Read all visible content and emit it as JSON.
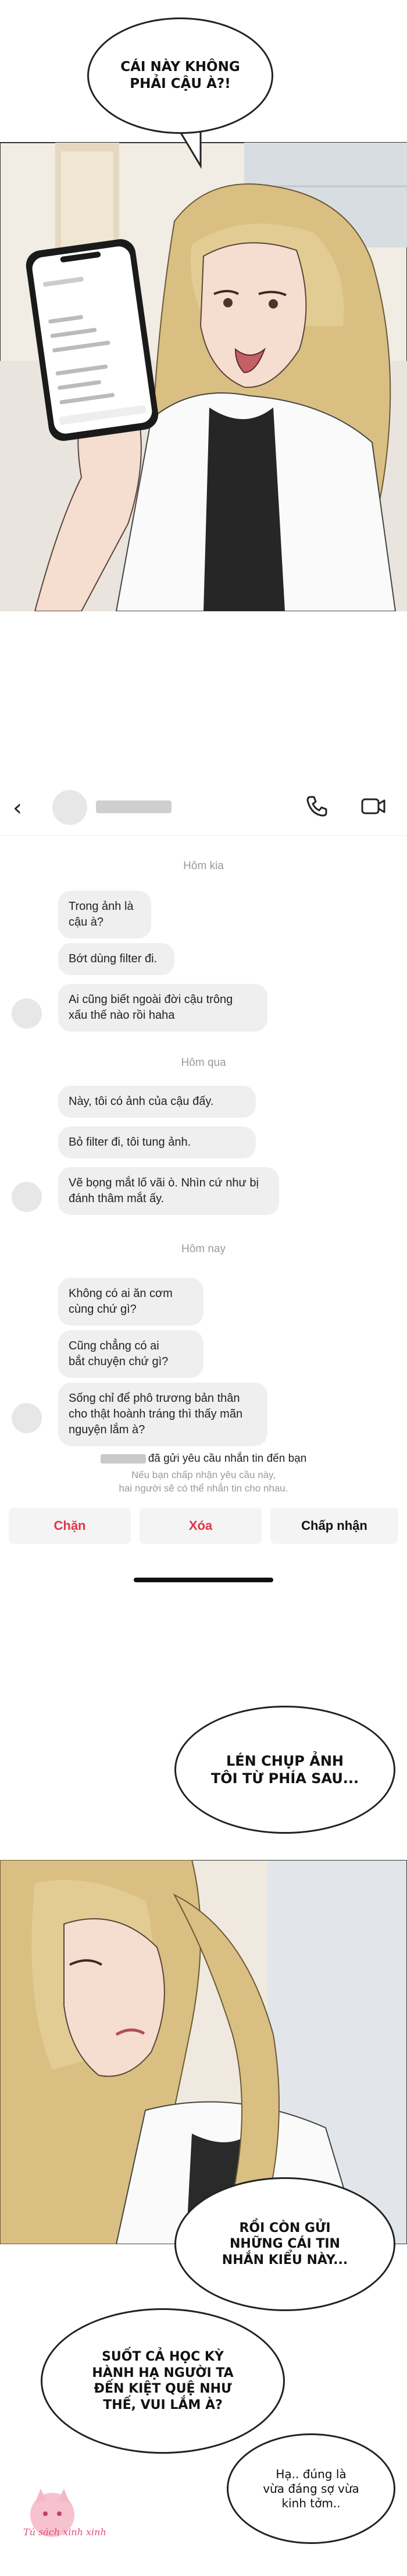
{
  "panel1": {
    "bubble": "CÁI NÀY KHÔNG\nPHẢI CẬU À?!"
  },
  "chat": {
    "days": [
      "Hôm kia",
      "Hôm qua",
      "Hôm nay"
    ],
    "messages_day1": [
      "Trong ảnh là\ncậu à?",
      "Bớt dùng filter đi.",
      "Ai cũng biết ngoài đời cậu trông\nxấu thế nào rồi haha"
    ],
    "messages_day2": [
      "Này, tôi có ảnh của cậu đấy.",
      "Bỏ filter đi, tôi tung ảnh.",
      "Vẽ bọng mắt lố vãi ò. Nhìn cứ như bị\nđánh thâm mắt ấy."
    ],
    "messages_day3": [
      "Không có ai ăn cơm\ncùng chứ gì?",
      "Cũng chẳng có ai\nbắt chuyện chứ gì?",
      "Sống chỉ để phô trương bản thân\ncho thật hoành tráng thì thấy mãn\nnguyện lắm à?"
    ],
    "notice_title": "đã gửi yêu cầu nhắn tin đến bạn",
    "notice_sub": "Nếu bạn chấp nhận yêu cầu này,\nhai người sẽ có thể nhắn tin cho nhau.",
    "buttons": {
      "block": "Chặn",
      "delete": "Xóa",
      "accept": "Chấp nhận"
    },
    "colors": {
      "block": "#e0344b",
      "delete": "#e0344b",
      "accept": "#111111"
    }
  },
  "panel2": {
    "bubble": "LÉN CHỤP ẢNH\nTÔI TỪ PHÍA SAU..."
  },
  "panel3": {
    "bubble1": "RỒI CÒN GỬI\nNHỮNG CÁI TIN\nNHẮN KIỂU NÀY...",
    "bubble2": "SUỐT CẢ HỌC KỲ\nHÀNH HẠ NGƯỜI TA\nĐẾN KIỆT QUỆ NHƯ\nTHẾ, VUI LẮM À?",
    "bubble3": "Hạ.. đúng là\nvừa đáng sợ vừa\nkinh tởm.."
  },
  "credit": "Tú sách xinh xinh"
}
